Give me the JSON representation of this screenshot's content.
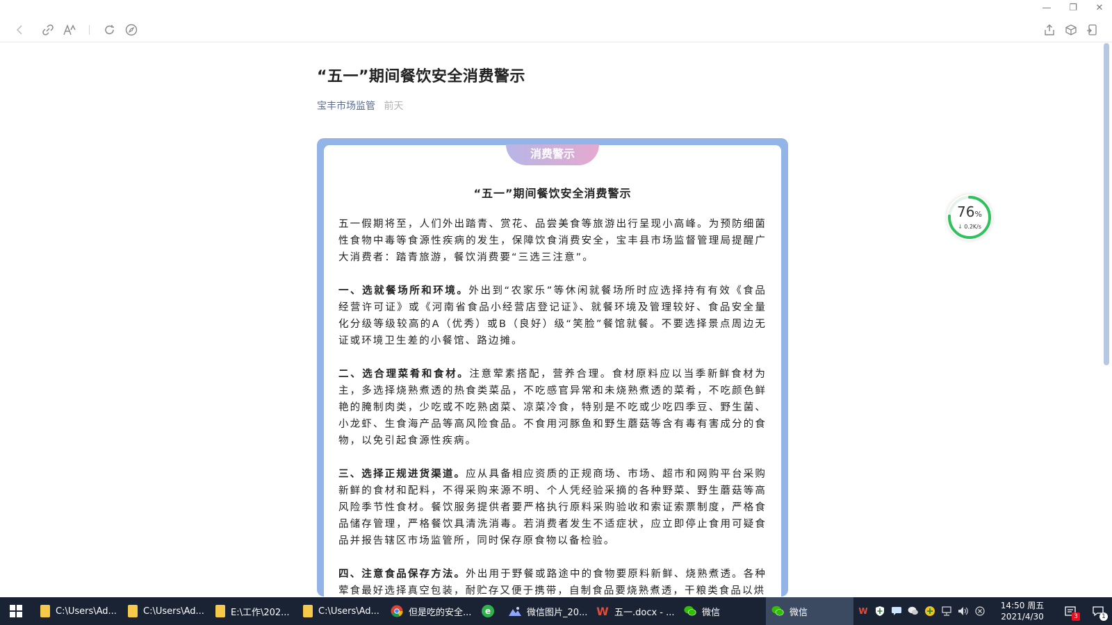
{
  "window": {
    "minimize_glyph": "—",
    "restore_glyph": "❐",
    "close_glyph": "✕"
  },
  "toolbar": {
    "icons": [
      "back-icon",
      "link-icon",
      "font-size-icon",
      "refresh-icon",
      "compass-icon",
      "share-icon",
      "cube-icon",
      "phone-icon"
    ]
  },
  "article": {
    "title": "“五一”期间餐饮安全消费警示",
    "source": "宝丰市场监管",
    "time": "前天"
  },
  "card": {
    "badge": "消费警示",
    "title": "“五一”期间餐饮安全消费警示",
    "intro": "五一假期将至，人们外出踏青、赏花、品尝美食等旅游出行呈现小高峰。为预防细菌性食物中毒等食源性疾病的发生，保障饮食消费安全，宝丰县市场监督管理局提醒广大消费者：踏青旅游，餐饮消费要“三选三注意”。",
    "sections": [
      {
        "heading": "一、选就餐场所和环境。",
        "text": "外出到“农家乐”等休闲就餐场所时应选择持有有效《食品经营许可证》或《河南省食品小经营店登记证》、就餐环境及管理较好、食品安全量化分级等级较高的A（优秀）或B（良好）级“笑脸”餐馆就餐。不要选择景点周边无证或环境卫生差的小餐馆、路边摊。"
      },
      {
        "heading": "二、选合理菜肴和食材。",
        "text": "注意荤素搭配，营养合理。食材原料应以当季新鲜食材为主，多选择烧熟煮透的热食类菜品，不吃感官异常和未烧熟煮透的菜肴，不吃颜色鲜艳的腌制肉类，少吃或不吃熟卤菜、凉菜冷食，特别是不吃或少吃四季豆、野生菌、小龙虾、生食海产品等高风险食品。不食用河豚鱼和野生蘑菇等含有毒有害成分的食物，以免引起食源性疾病。"
      },
      {
        "heading": "三、选择正规进货渠道。",
        "text": "应从具备相应资质的正规商场、市场、超市和网购平台采购新鲜的食材和配料，不得采购来源不明、个人凭经验采摘的各种野菜、野生蘑菇等高风险季节性食材。餐饮服务提供者要严格执行原料采购验收和索证索票制度，严格食品储存管理，严格餐饮具清洗消毒。若消费者发生不适症状，应立即停止食用可疑食品并报告辖区市场监管所，同时保存原食物以备检验。"
      },
      {
        "heading": "四、注意食品保存方法。",
        "text": "外出用于野餐或路途中的食物要原料新鲜、烧熟煮透。各种荤食最好选择真空包装，耐贮存又便于携带，自制食品要烧熟煮透，干粮类食品以烘"
      }
    ]
  },
  "speed_widget": {
    "percent": "76",
    "percent_unit": "%",
    "percent_value": 0.76,
    "rate": "0.2K/s",
    "arrow": "↓"
  },
  "taskbar": {
    "tasks": [
      {
        "label": "C:\\Users\\Ad...",
        "icon": "folder-icon",
        "active": false
      },
      {
        "label": "C:\\Users\\Ad...",
        "icon": "folder-icon",
        "active": false
      },
      {
        "label": "E:\\工作\\202...",
        "icon": "folder-icon",
        "active": false
      },
      {
        "label": "C:\\Users\\Ad...",
        "icon": "folder-icon",
        "active": false
      },
      {
        "label": "但是吃的安全...",
        "icon": "chrome-icon",
        "active": false
      },
      {
        "label": "",
        "icon": "browser-e-icon",
        "active": false
      },
      {
        "label": "微信图片_20...",
        "icon": "photos-icon",
        "active": false
      },
      {
        "label": "五一.docx - ...",
        "icon": "wps-icon",
        "active": false
      },
      {
        "label": "微信",
        "icon": "wechat-icon",
        "active": false
      },
      {
        "label": "微信",
        "icon": "wechat-icon",
        "active": true
      }
    ],
    "time": "14:50 周五",
    "date": "2021/4/30",
    "notification_count": "3",
    "action_center_count": "1",
    "colors": {
      "background": "#1a2333",
      "active": "#3b4a60"
    }
  }
}
